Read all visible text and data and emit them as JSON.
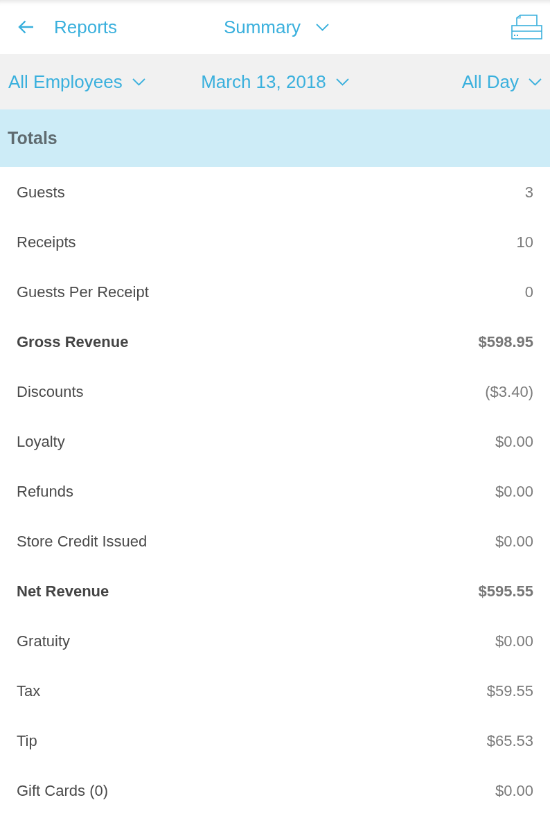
{
  "app_bar": {
    "back_label": "Reports",
    "view": "Summary"
  },
  "filters": [
    {
      "label": "All Employees"
    },
    {
      "label": "March 13, 2018"
    },
    {
      "label": "All Day"
    }
  ],
  "section": {
    "title": "Totals"
  },
  "rows": [
    {
      "label": "Guests",
      "value": "3",
      "kind": "item"
    },
    {
      "label": "Receipts",
      "value": "10",
      "kind": "item"
    },
    {
      "label": "Guests Per Receipt",
      "value": "0",
      "kind": "item"
    },
    {
      "label": "Gross Revenue",
      "value": "$598.95",
      "kind": "total"
    },
    {
      "label": "Discounts",
      "value": "($3.40)",
      "kind": "item"
    },
    {
      "label": "Loyalty",
      "value": "$0.00",
      "kind": "item"
    },
    {
      "label": "Refunds",
      "value": "$0.00",
      "kind": "item"
    },
    {
      "label": "Store Credit Issued",
      "value": "$0.00",
      "kind": "item"
    },
    {
      "label": "Net Revenue",
      "value": "$595.55",
      "kind": "total"
    },
    {
      "label": "Gratuity",
      "value": "$0.00",
      "kind": "item"
    },
    {
      "label": "Tax",
      "value": "$59.55",
      "kind": "item"
    },
    {
      "label": "Tip",
      "value": "$65.53",
      "kind": "item"
    },
    {
      "label": "Gift Cards (0)",
      "value": "$0.00",
      "kind": "item"
    }
  ]
}
